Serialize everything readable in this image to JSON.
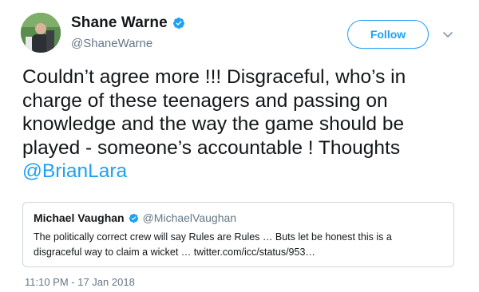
{
  "author": {
    "display_name": "Shane Warne",
    "handle": "@ShaneWarne",
    "verified": true,
    "avatar": "profile-photo"
  },
  "follow_button": {
    "label": "Follow"
  },
  "more_menu_icon": "chevron-down-icon",
  "tweet": {
    "lines": [
      "Couldn’t agree more !!! Disgraceful, who’s in",
      "charge of these teenagers and passing on",
      "knowledge and the way the game should be",
      "played - someone’s accountable ! Thoughts"
    ],
    "mention": "@BrianLara"
  },
  "quoted_tweet": {
    "display_name": "Michael Vaughan",
    "handle": "@MichaelVaughan",
    "verified": true,
    "lines": [
      "The politically correct crew will say Rules are Rules … Buts let be honest this is a",
      "disgraceful way to claim a wicket … twitter.com/icc/status/953…"
    ]
  },
  "timestamp": "11:10 PM - 17 Jan 2018",
  "colors": {
    "accent": "#1da1f2",
    "secondary_text": "#657786",
    "primary_text": "#14171a",
    "border": "#ccd6dd"
  }
}
